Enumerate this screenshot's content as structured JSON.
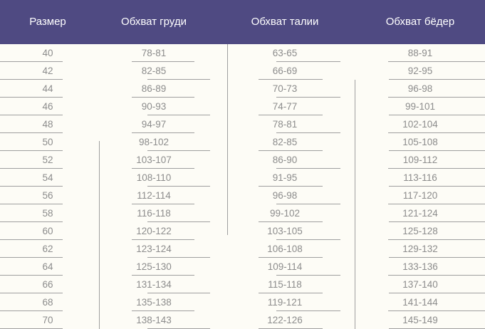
{
  "table": {
    "headers": [
      "Размер",
      "Обхват груди",
      "Обхват талии",
      "Обхват бёдер"
    ],
    "rows": [
      [
        "40",
        "78-81",
        "63-65",
        "88-91"
      ],
      [
        "42",
        "82-85",
        "66-69",
        "92-95"
      ],
      [
        "44",
        "86-89",
        "70-73",
        "96-98"
      ],
      [
        "46",
        "90-93",
        "74-77",
        "99-101"
      ],
      [
        "48",
        "94-97",
        "78-81",
        "102-104"
      ],
      [
        "50",
        "98-102",
        "82-85",
        "105-108"
      ],
      [
        "52",
        "103-107",
        "86-90",
        "109-112"
      ],
      [
        "54",
        "108-110",
        "91-95",
        "113-116"
      ],
      [
        "56",
        "112-114",
        "96-98",
        "117-120"
      ],
      [
        "58",
        "116-118",
        "99-102",
        "121-124"
      ],
      [
        "60",
        "120-122",
        "103-105",
        "125-128"
      ],
      [
        "62",
        "123-124",
        "106-108",
        "129-132"
      ],
      [
        "64",
        "125-130",
        "109-114",
        "133-136"
      ],
      [
        "66",
        "131-134",
        "115-118",
        "137-140"
      ],
      [
        "68",
        "135-138",
        "119-121",
        "141-144"
      ],
      [
        "70",
        "138-143",
        "122-126",
        "145-149"
      ]
    ]
  },
  "colors": {
    "header_bg": "#4f4a82",
    "header_text": "#ffffff",
    "page_bg": "#fdfcf6",
    "cell_text": "#8c8c8c",
    "rule": "#9f9f9f"
  }
}
